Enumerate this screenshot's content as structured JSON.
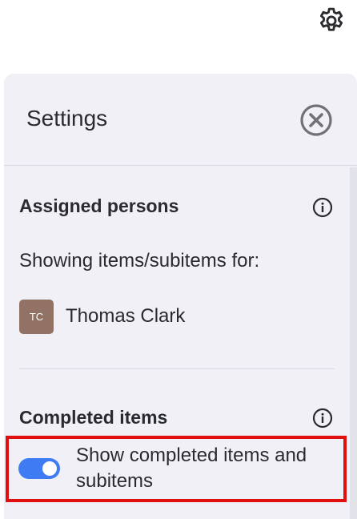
{
  "panel": {
    "title": "Settings"
  },
  "assigned": {
    "heading": "Assigned persons",
    "subtext": "Showing items/subitems for:",
    "person": {
      "initials": "TC",
      "name": "Thomas Clark",
      "avatar_color": "#917264"
    }
  },
  "completed": {
    "heading": "Completed items",
    "toggle_label": "Show completed items and subitems",
    "toggle_on": true,
    "toggle_color": "#3f7cf3"
  },
  "icons": {
    "settings": "gear-icon",
    "close": "close-circle-icon",
    "info": "info-circle-icon"
  },
  "highlight_color": "#e01010"
}
